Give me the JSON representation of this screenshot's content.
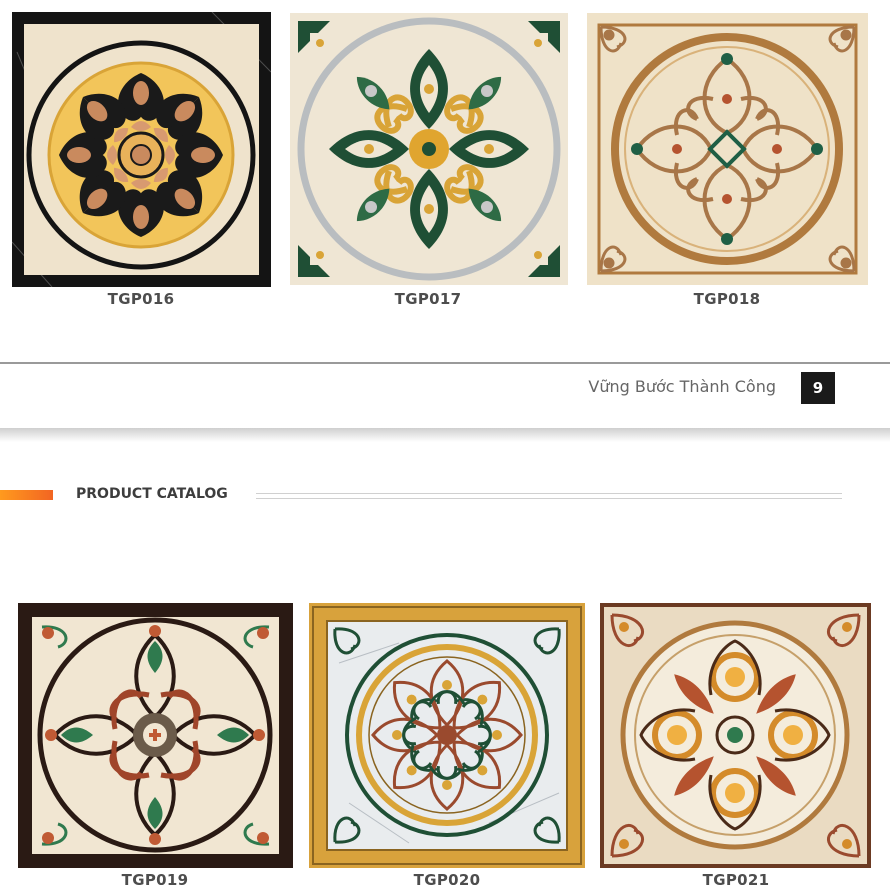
{
  "products": [
    {
      "code": "TGP016"
    },
    {
      "code": "TGP017"
    },
    {
      "code": "TGP018"
    },
    {
      "code": "TGP019"
    },
    {
      "code": "TGP020"
    },
    {
      "code": "TGP021"
    }
  ],
  "footer": {
    "slogan": "Vững Bước Thành Công",
    "page_number": "9"
  },
  "section": {
    "title": "PRODUCT CATALOG"
  },
  "colors": {
    "accent_orange": "#f26522",
    "beige": "#efe3cc",
    "black_marble": "#141414",
    "dark_green": "#1f4f35",
    "gold": "#d9a437",
    "brown": "#8a5a2b"
  }
}
